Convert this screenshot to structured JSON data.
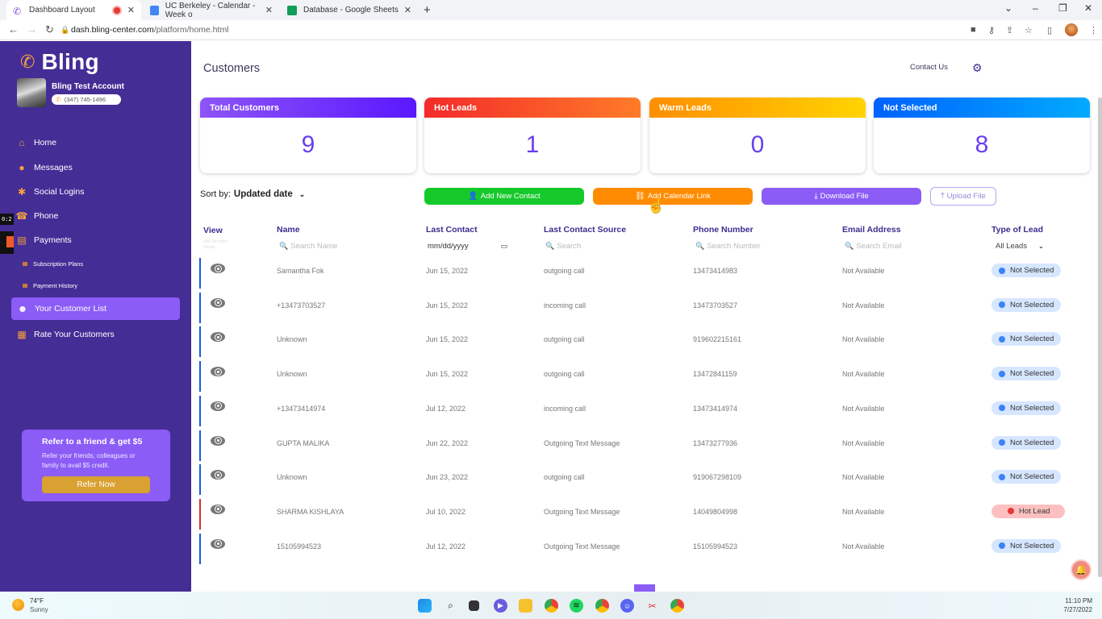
{
  "browser": {
    "tabs": [
      {
        "title": "Dashboard Layout",
        "active": true,
        "recording": true
      },
      {
        "title": "UC Berkeley - Calendar - Week o",
        "active": false
      },
      {
        "title": "Database - Google Sheets",
        "active": false
      }
    ],
    "new_tab": "+",
    "url_host": "dash.bling-center.com",
    "url_path": "/platform/home.html",
    "window_controls": {
      "dropdown": "⌄",
      "minimize": "–",
      "restore": "❐",
      "close": "✕"
    }
  },
  "sidebar": {
    "brand": "Bling",
    "account_name": "Bling Test Account",
    "account_phone": "(347) 745-1496",
    "screen_recorder_time": "0:2",
    "items": [
      {
        "label": "Home",
        "icon": "home-icon",
        "glyph": "⌂"
      },
      {
        "label": "Messages",
        "icon": "messages-icon",
        "glyph": "💬"
      },
      {
        "label": "Social Logins",
        "icon": "users-icon",
        "glyph": "✱"
      },
      {
        "label": "Phone",
        "icon": "phone-icon",
        "glyph": "☎"
      },
      {
        "label": "Payments",
        "icon": "payments-icon",
        "glyph": "▤"
      },
      {
        "label": "Subscription Plans",
        "icon": "subscription-icon",
        "sub": true
      },
      {
        "label": "Payment History",
        "icon": "history-icon",
        "sub": true
      },
      {
        "label": "Your Customer List",
        "icon": "customer-list-icon",
        "glyph": "☻",
        "active": true
      },
      {
        "label": "Rate Your Customers",
        "icon": "rate-icon",
        "glyph": "▦"
      }
    ],
    "refer": {
      "title": "Refer to a friend & get $5",
      "text": "Refer your friends, colleagues or family to avail $5 credit.",
      "button": "Refer Now"
    }
  },
  "header": {
    "title": "Customers",
    "contact_us": "Contact Us"
  },
  "stats": [
    {
      "label": "Total Customers",
      "value": "9",
      "gradient": [
        "#8e55f7",
        "#5a18ff"
      ]
    },
    {
      "label": "Hot Leads",
      "value": "1",
      "gradient": [
        "#f42a2a",
        "#ff7b28"
      ]
    },
    {
      "label": "Warm Leads",
      "value": "0",
      "gradient": [
        "#ff8e00",
        "#ffd400"
      ]
    },
    {
      "label": "Not Selected",
      "value": "8",
      "gradient": [
        "#0062ff",
        "#00aaff"
      ]
    }
  ],
  "toolbar": {
    "sort_label": "Sort by:",
    "sort_value": "Updated date",
    "add_contact": "Add New Contact",
    "add_calendar": "Add Calendar Link",
    "download": "Download File",
    "upload": "Upload File"
  },
  "table": {
    "columns": [
      "View",
      "Name",
      "Last Contact",
      "Last Contact Source",
      "Phone Number",
      "Email Address",
      "Type of Lead"
    ],
    "view_hint": "click for more details",
    "filters": {
      "name": "Search Name",
      "date": "mm/dd/yyyy",
      "source": "Search",
      "phone": "Search Number",
      "email": "Search Email",
      "lead": "All Leads"
    },
    "rows": [
      {
        "name": "Samantha Fok",
        "last_contact": "Jun 15, 2022",
        "source": "outgoing call",
        "phone": "13473414983",
        "email": "Not Available",
        "lead": "Not Selected"
      },
      {
        "name": "+13473703527",
        "last_contact": "Jun 15, 2022",
        "source": "incoming call",
        "phone": "13473703527",
        "email": "Not Available",
        "lead": "Not Selected"
      },
      {
        "name": "Unknown",
        "last_contact": "Jun 15, 2022",
        "source": "outgoing call",
        "phone": "919602215161",
        "email": "Not Available",
        "lead": "Not Selected"
      },
      {
        "name": "Unknown",
        "last_contact": "Jun 15, 2022",
        "source": "outgoing call",
        "phone": "13472841159",
        "email": "Not Available",
        "lead": "Not Selected"
      },
      {
        "name": "+13473414974",
        "last_contact": "Jul 12, 2022",
        "source": "incoming call",
        "phone": "13473414974",
        "email": "Not Available",
        "lead": "Not Selected"
      },
      {
        "name": "GUPTA MALIKA",
        "last_contact": "Jun 22, 2022",
        "source": "Outgoing Text Message",
        "phone": "13473277936",
        "email": "Not Available",
        "lead": "Not Selected"
      },
      {
        "name": "Unknown",
        "last_contact": "Jun 23, 2022",
        "source": "outgoing call",
        "phone": "919067298109",
        "email": "Not Available",
        "lead": "Not Selected"
      },
      {
        "name": "SHARMA KISHLAYA",
        "last_contact": "Jul 10, 2022",
        "source": "Outgoing Text Message",
        "phone": "14049804998",
        "email": "Not Available",
        "lead": "Hot Lead"
      },
      {
        "name": "15105994523",
        "last_contact": "Jul 12, 2022",
        "source": "Outgoing Text Message",
        "phone": "15105994523",
        "email": "Not Available",
        "lead": "Not Selected"
      }
    ]
  },
  "taskbar": {
    "weather_temp": "74°F",
    "weather_desc": "Sunny",
    "time": "11:10 PM",
    "date": "7/27/2022"
  }
}
